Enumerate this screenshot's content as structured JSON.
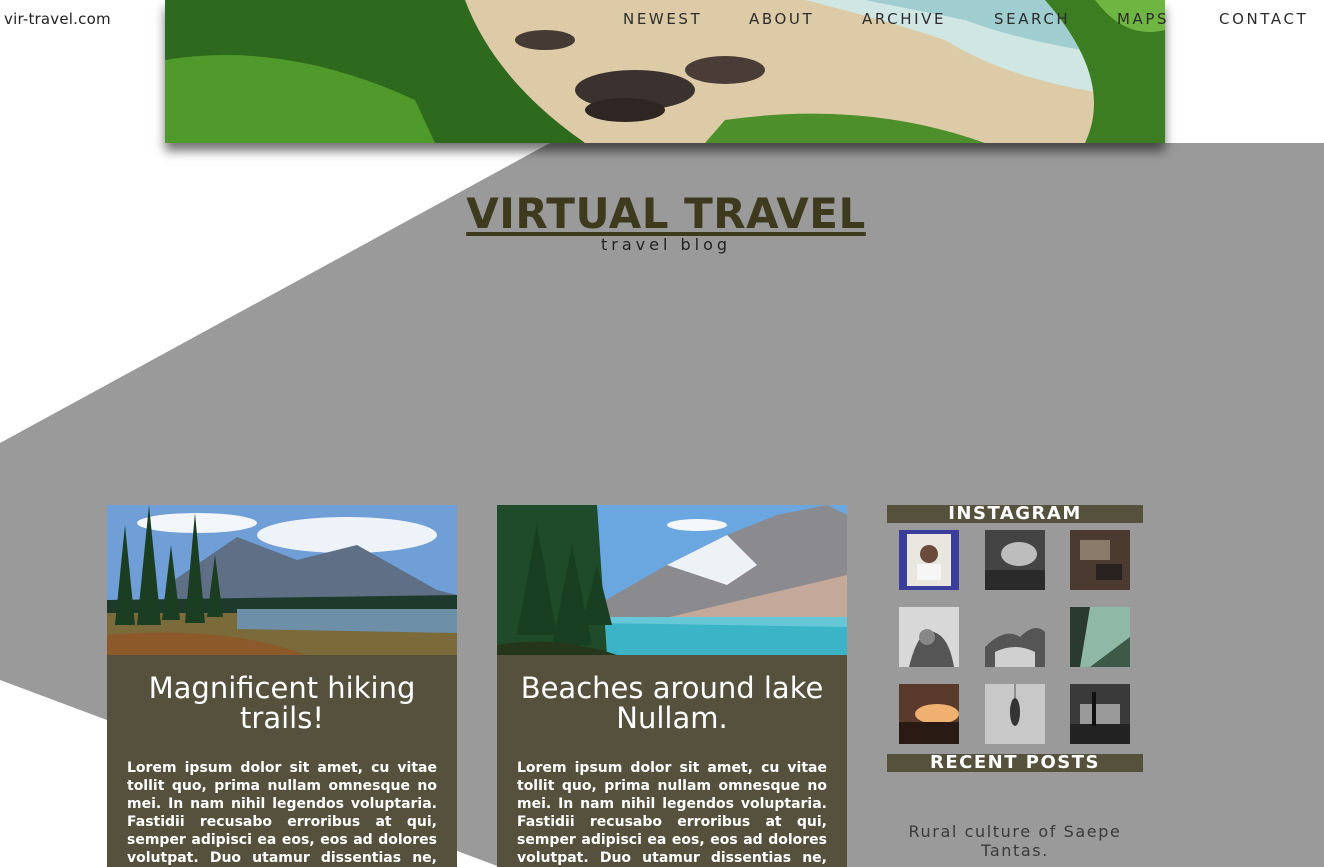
{
  "site": {
    "url": "vir-travel.com",
    "title": "VIRTUAL TRAVEL",
    "subtitle": "travel blog"
  },
  "nav": {
    "items": [
      {
        "label": "NEWEST"
      },
      {
        "label": "ABOUT"
      },
      {
        "label": "ARCHIVE"
      },
      {
        "label": "SEARCH"
      },
      {
        "label": "MAPS"
      },
      {
        "label": "CONTACT"
      }
    ]
  },
  "posts": [
    {
      "title": "Magnificent hiking trails!",
      "excerpt": "Lorem ipsum dolor sit amet, cu vitae tollit quo, prima nullam omnesque no mei. In nam nihil legendos voluptaria. Fastidii recusabo erroribus at qui, semper adipisci ea eos, eos ad dolores volutpat. Duo utamur dissentias ne, vix in nobis oportere voluptaria ut, fastidii"
    },
    {
      "title": "Beaches around lake Nullam.",
      "excerpt": "Lorem ipsum dolor sit amet, cu vitae tollit quo, prima nullam omnesque no mei. In nam nihil legendos voluptaria. Fastidii recusabo erroribus at qui, semper adipisci ea eos, eos ad dolores volutpat. Duo utamur dissentias ne, vix in nobis oportere voluptaria ut, fastidii"
    }
  ],
  "sidebar": {
    "instagram_heading": "INSTAGRAM",
    "recent_heading": "RECENT POSTS",
    "recent_posts": [
      {
        "title": "Rural culture of Saepe Tantas."
      }
    ]
  },
  "colors": {
    "accent": "#55513d",
    "background_gray": "#9a9a9a",
    "logo": "#3d3a1e"
  }
}
